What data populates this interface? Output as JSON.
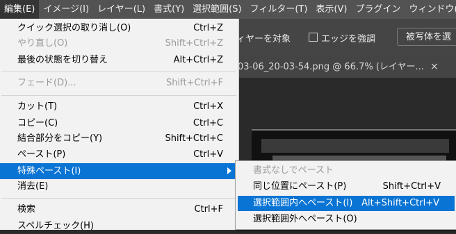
{
  "menubar": {
    "items": [
      "編集(E)",
      "イメージ(I)",
      "レイヤー(L)",
      "書式(Y)",
      "選択範囲(S)",
      "フィルター(T)",
      "表示(V)",
      "プラグイン",
      "ウィンドウ(W"
    ],
    "active_index": 0
  },
  "options": {
    "layer_target": "ィヤーを対象",
    "enhance_edge": "エッジを強調",
    "subject_button": "被写体を選"
  },
  "document_tab": {
    "title": "03-06_20-03-54.png @ 66.7% (レイヤー...",
    "close": "×"
  },
  "edit_menu": {
    "items": [
      {
        "label": "クイック選択の取り消し(O)",
        "shortcut": "Ctrl+Z",
        "disabled": false
      },
      {
        "label": "やり直し(O)",
        "shortcut": "Shift+Ctrl+Z",
        "disabled": true
      },
      {
        "label": "最後の状態を切り替え",
        "shortcut": "Alt+Ctrl+Z",
        "disabled": false
      },
      {
        "label": "フェード(D)...",
        "shortcut": "Shift+Ctrl+F",
        "disabled": true
      },
      {
        "label": "カット(T)",
        "shortcut": "Ctrl+X",
        "disabled": false
      },
      {
        "label": "コピー(C)",
        "shortcut": "Ctrl+C",
        "disabled": false
      },
      {
        "label": "結合部分をコピー(Y)",
        "shortcut": "Shift+Ctrl+C",
        "disabled": false
      },
      {
        "label": "ペースト(P)",
        "shortcut": "Ctrl+V",
        "disabled": false
      },
      {
        "label": "特殊ペースト(I)",
        "shortcut": "",
        "disabled": false,
        "highlighted": true,
        "submenu": true
      },
      {
        "label": "消去(E)",
        "shortcut": "",
        "disabled": false
      },
      {
        "label": "検索",
        "shortcut": "Ctrl+F",
        "disabled": false
      },
      {
        "label": "スペルチェック(H)",
        "shortcut": "",
        "disabled": false
      }
    ]
  },
  "paste_special_submenu": {
    "items": [
      {
        "label": "書式なしでペースト",
        "shortcut": "",
        "disabled": true
      },
      {
        "label": "同じ位置にペースト(P)",
        "shortcut": "Shift+Ctrl+V",
        "disabled": false
      },
      {
        "label": "選択範囲内へペースト(I)",
        "shortcut": "Alt+Shift+Ctrl+V",
        "disabled": false,
        "highlighted": true
      },
      {
        "label": "選択範囲外へペースト(O)",
        "shortcut": "",
        "disabled": false
      }
    ]
  },
  "colors": {
    "highlight": "#0a74d4",
    "menu_bg": "#f2f2f2",
    "menubar_bg": "#535353"
  }
}
